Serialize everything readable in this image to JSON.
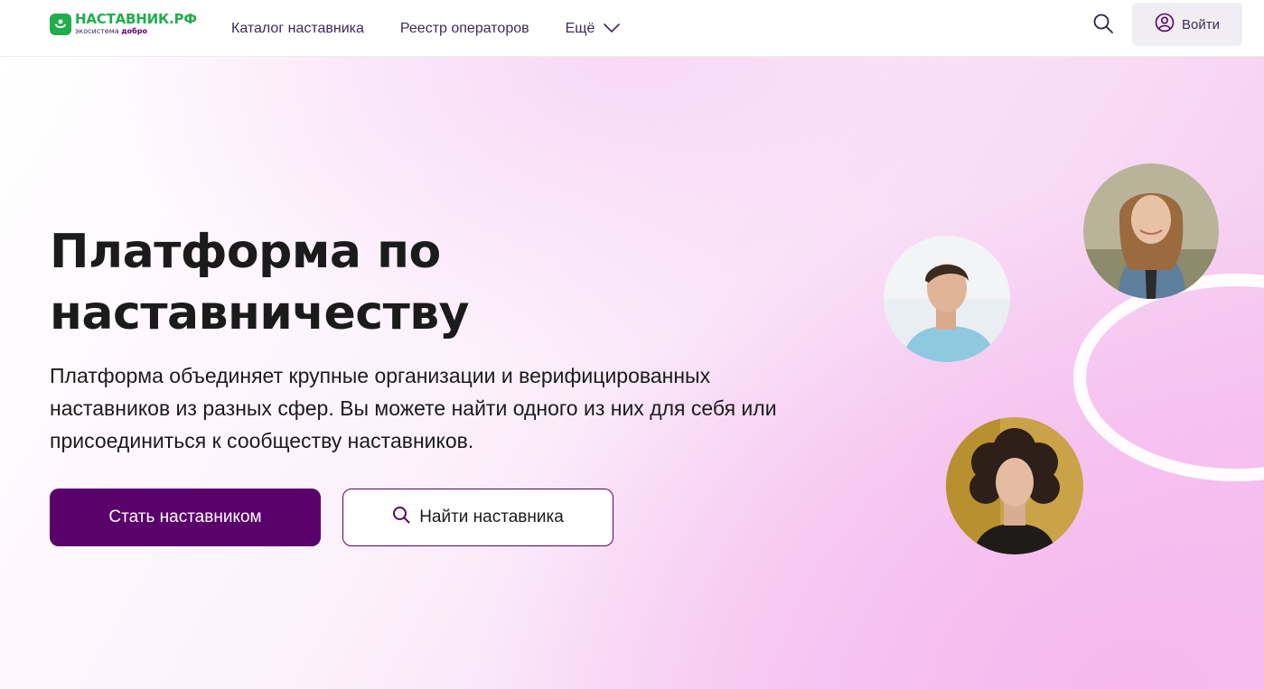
{
  "header": {
    "logo": {
      "title": "НАСТАВНИК.РФ",
      "sub_prefix": "экосистема",
      "sub_brand": "добро"
    },
    "nav": [
      {
        "label": "Каталог наставника"
      },
      {
        "label": "Реестр операторов"
      },
      {
        "label": "Ещё"
      }
    ],
    "login_label": "Войти"
  },
  "hero": {
    "title_line1": "Платформа по",
    "title_line2": "наставничеству",
    "description": "Платформа объединяет крупные организации и верифицированных наставников из разных сфер. Вы можете найти одного из них для себя или присоединиться к сообществу наставников.",
    "primary_button": "Стать наставником",
    "secondary_button": "Найти наставника"
  },
  "colors": {
    "brand_green": "#1fae4b",
    "brand_purple": "#5a006b",
    "nav_text": "#3b2a5c",
    "hero_pink": "#f3c4ef"
  },
  "icons": [
    "search-icon",
    "user-circle-icon",
    "chevron-down-icon"
  ]
}
